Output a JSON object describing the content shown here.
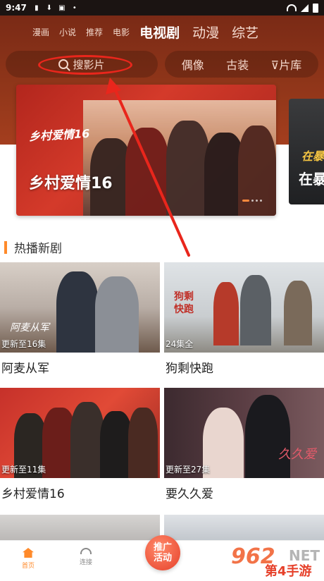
{
  "status_bar": {
    "time": "9:47"
  },
  "top_tabs": {
    "small": [
      "漫画",
      "小说",
      "推荐",
      "电影"
    ],
    "big": [
      "电视剧",
      "动漫",
      "综艺"
    ],
    "active": "电视剧"
  },
  "search": {
    "placeholder": "搜影片"
  },
  "filters": [
    "偶像",
    "古装",
    "片库"
  ],
  "banner": {
    "logo": "乡村爱情16",
    "title": "乡村爱情16"
  },
  "next_banner": {
    "line1": "在暴",
    "line2": "在暴"
  },
  "section": {
    "title": "热播新剧"
  },
  "cards": [
    {
      "name": "阿麦从军",
      "badge": "更新至16集",
      "art_text": "阿麦从军"
    },
    {
      "name": "狗剩快跑",
      "badge": "24集全",
      "art_text": "狗剩快跑"
    },
    {
      "name": "乡村爱情16",
      "badge": "更新至11集",
      "art_text": ""
    },
    {
      "name": "要久久爱",
      "badge": "更新至27集",
      "art_text": "久久爱"
    }
  ],
  "bottom_nav": {
    "home": "首页",
    "connect": "连接",
    "promo_line1": "推广",
    "promo_line2": "活动"
  },
  "watermark": {
    "num": "962",
    "net": "NET",
    "cn": "第4手游"
  },
  "colors": {
    "accent": "#ff8a2a",
    "header": "#8e3519",
    "highlight": "#e9261c"
  }
}
